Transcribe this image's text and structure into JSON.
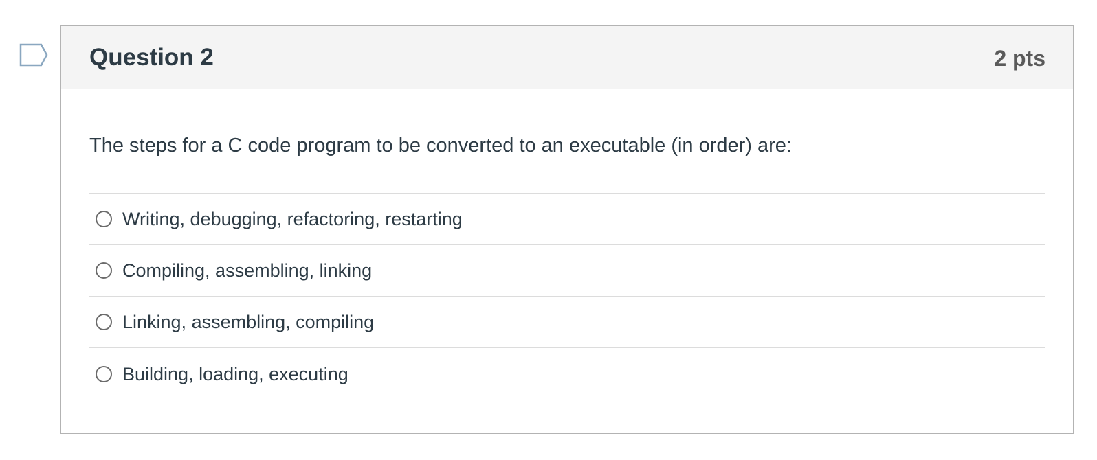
{
  "flag": {
    "icon": "flag-icon",
    "color": "#8aa7c0"
  },
  "question": {
    "title": "Question 2",
    "points": "2 pts",
    "text": "The steps for a C code program to be converted to an executable (in order) are:",
    "answers": [
      {
        "label": "Writing, debugging, refactoring, restarting",
        "selected": false
      },
      {
        "label": "Compiling, assembling, linking",
        "selected": false
      },
      {
        "label": "Linking, assembling, compiling",
        "selected": false
      },
      {
        "label": "Building, loading, executing",
        "selected": false
      }
    ]
  },
  "colors": {
    "header_bg": "#f4f4f4",
    "border": "#b3b3b3",
    "text": "#2d3b45",
    "points": "#5a5a5a"
  }
}
